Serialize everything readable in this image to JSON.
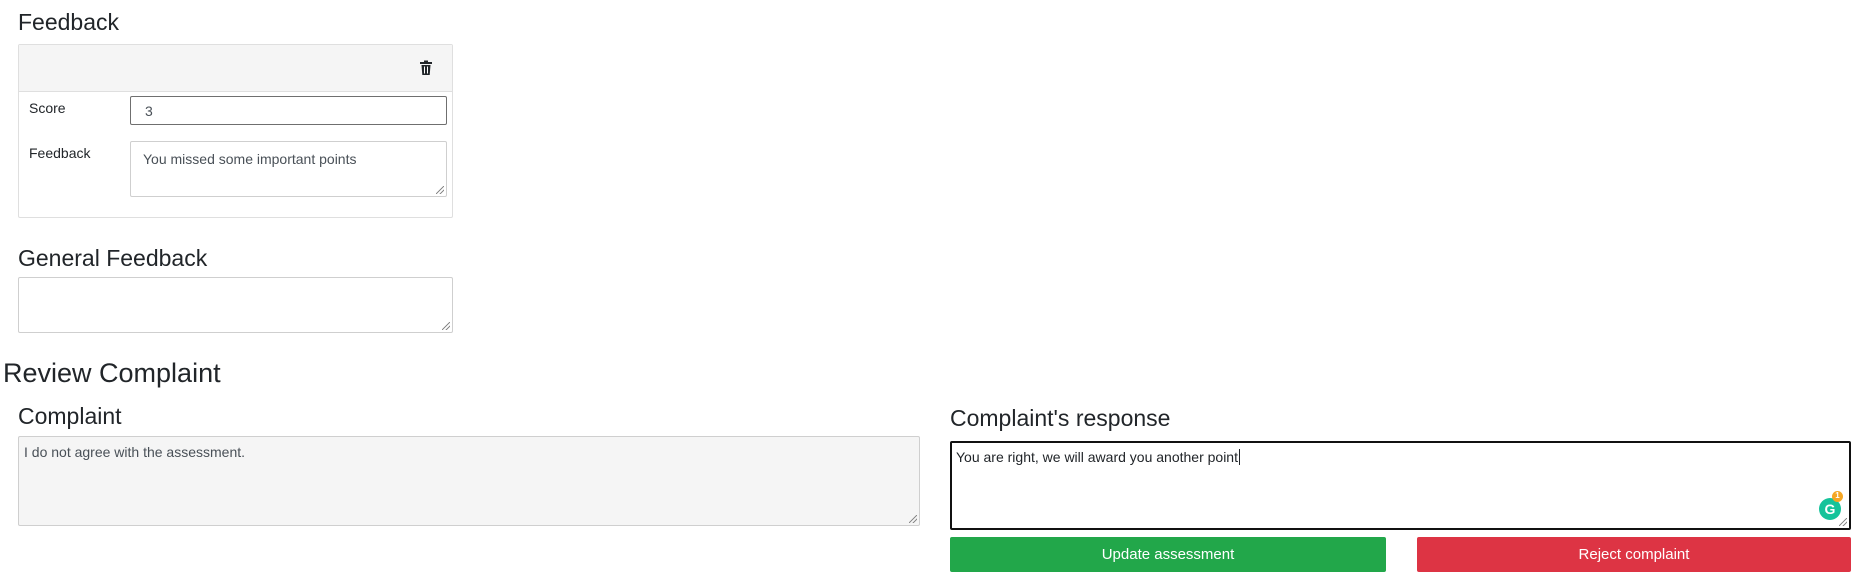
{
  "feedback_section": {
    "title": "Feedback",
    "card": {
      "score_label": "Score",
      "score_value": "3",
      "feedback_label": "Feedback",
      "feedback_text": "You missed some important points"
    }
  },
  "general_feedback": {
    "title": "General Feedback",
    "text": ""
  },
  "review_complaint": {
    "title": "Review Complaint",
    "complaint_title": "Complaint",
    "complaint_text": "I do not agree with the assessment.",
    "response_title": "Complaint's response",
    "response_text": "You are right, we will award you another point",
    "update_button": "Update assessment",
    "reject_button": "Reject complaint",
    "grammarly_badge_count": "1"
  },
  "colors": {
    "accept": "#22a74a",
    "reject": "#dd3444",
    "grammarly": "#15c39a"
  }
}
